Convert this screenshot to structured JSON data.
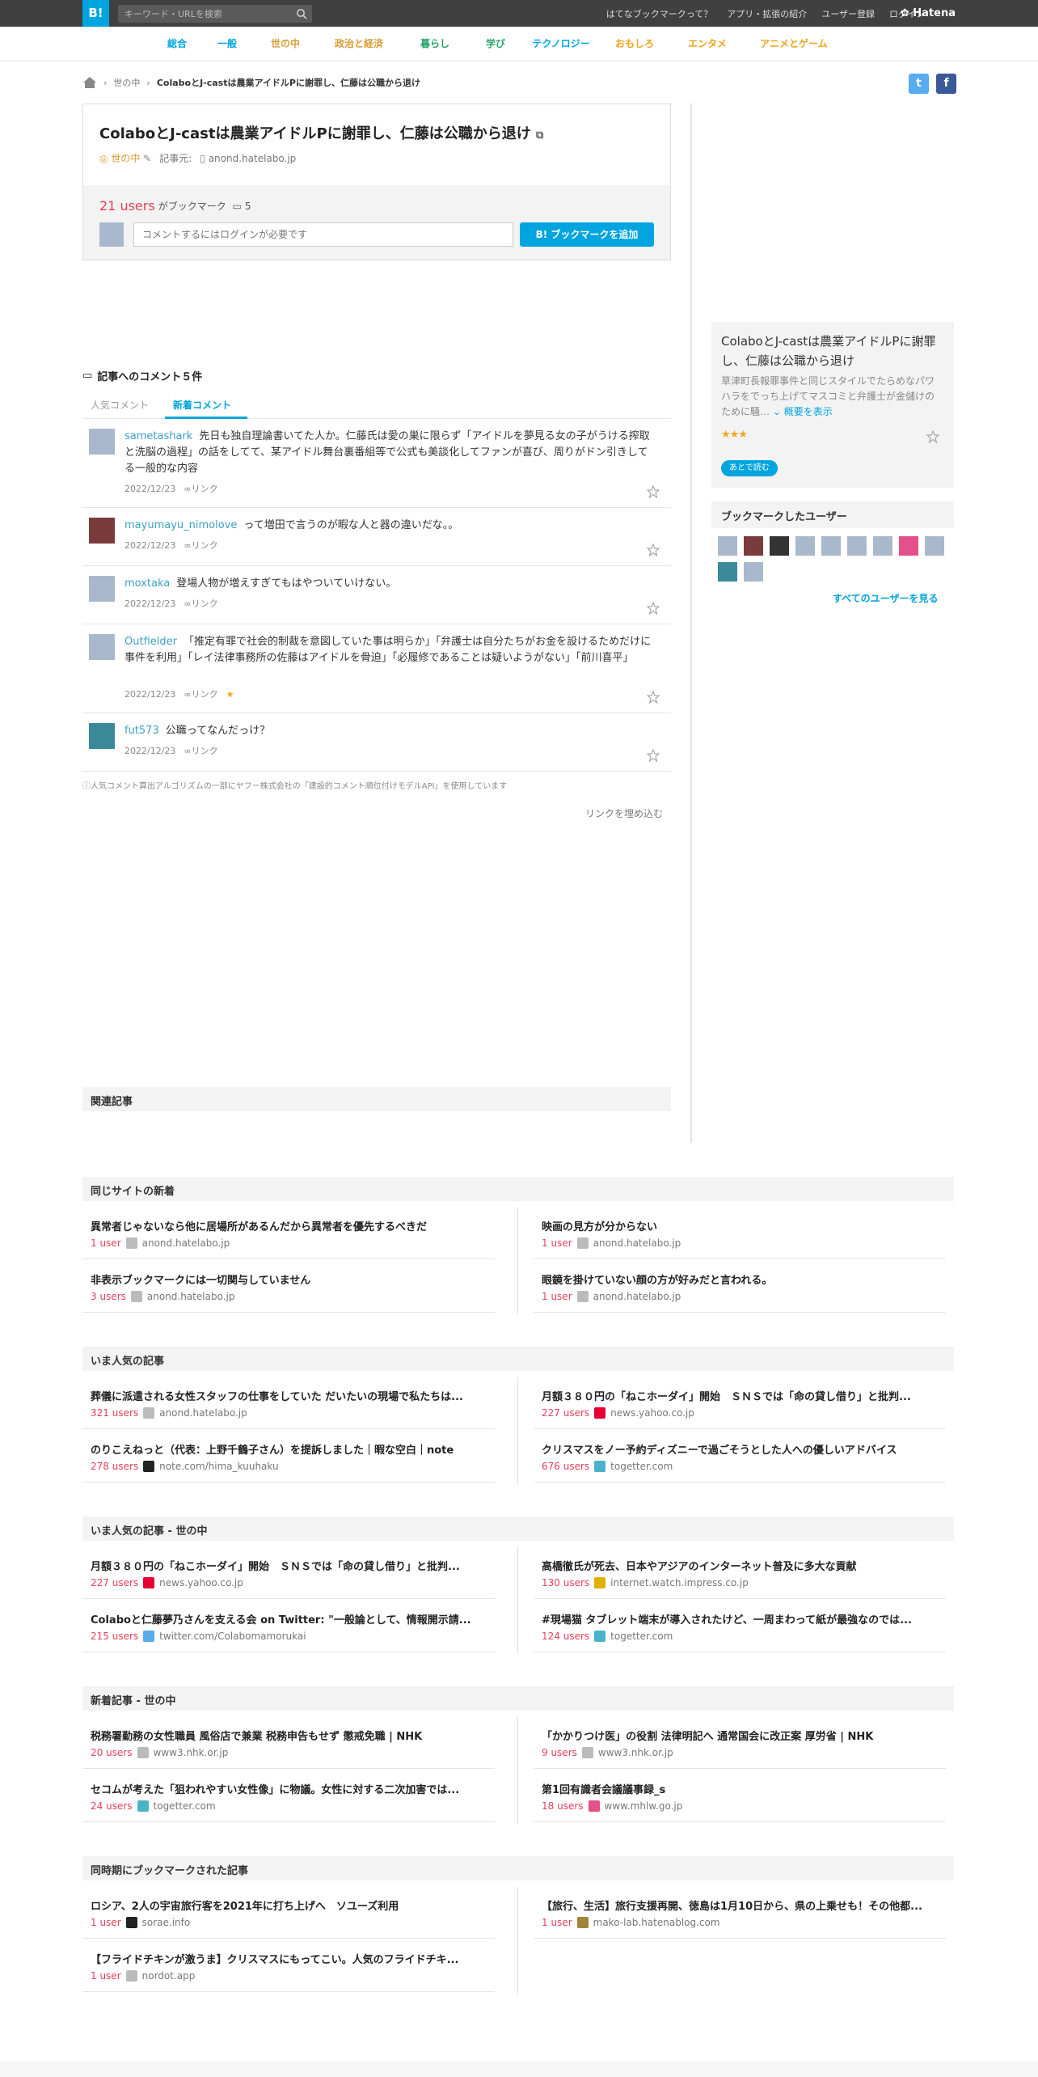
{
  "header": {
    "logo": "B!",
    "search_placeholder": "キーワード・URLを検索",
    "nav": [
      "はてなブックマークって？",
      "アプリ・拡張の紹介",
      "ユーザー登録",
      "ログイン"
    ],
    "brand": "Hatena"
  },
  "categories": [
    {
      "label": "総合",
      "color": "#00a4de"
    },
    {
      "label": "一般",
      "color": "#00a4de"
    },
    {
      "label": "世の中",
      "color": "#d79e3a"
    },
    {
      "label": "政治と経済",
      "color": "#d79e3a"
    },
    {
      "label": "暮らし",
      "color": "#2ba46e"
    },
    {
      "label": "学び",
      "color": "#2ba46e"
    },
    {
      "label": "テクノロジー",
      "color": "#00a4de"
    },
    {
      "label": "おもしろ",
      "color": "#f0a31d"
    },
    {
      "label": "エンタメ",
      "color": "#f0a31d"
    },
    {
      "label": "アニメとゲーム",
      "color": "#f0a31d"
    }
  ],
  "breadcrumb": {
    "category": "世の中",
    "current": "ColaboとJ-castは農業アイドルPに謝罪し、仁藤は公職から退け"
  },
  "entry": {
    "title": "ColaboとJ-castは農業アイドルPに謝罪し、仁藤は公職から退け",
    "category": "世の中",
    "source_label": "記事元:",
    "source": "anond.hatelabo.jp",
    "users_count": "21 users",
    "users_suffix": "がブックマーク",
    "comment_count": "5",
    "comment_placeholder": "コメントするにはログインが必要です",
    "bookmark_button": "ブックマークを追加"
  },
  "comments_section": {
    "heading": "記事へのコメント５件",
    "tab_popular": "人気コメント",
    "tab_new": "新着コメント",
    "link_label": "リンク",
    "items": [
      {
        "user": "sametashark",
        "text": "先日も独自理論書いてた人か。仁藤氏は愛の巣に限らず「アイドルを夢見る女の子がうける搾取と洗脳の過程」の話をしてて、某アイドル舞台裏番組等で公式も美談化してファンが喜び、周りがドン引きしてる一般的な内容",
        "date": "2022/12/23"
      },
      {
        "user": "mayumayu_nimolove",
        "text": "って増田で言うのが暇な人と器の違いだな。。",
        "date": "2022/12/23"
      },
      {
        "user": "moxtaka",
        "text": "登場人物が増えすぎてもはやついていけない。",
        "date": "2022/12/23"
      },
      {
        "user": "Outfielder",
        "text": "「推定有罪で社会的制裁を意図していた事は明らか」「弁護士は自分たちがお金を設けるためだけに事件を利用」「レイ法律事務所の佐藤はアイドルを骨迫」「必履修であることは疑いようがない」「前川喜平」",
        "date": "2022/12/23"
      },
      {
        "user": "fut573",
        "text": "公職ってなんだっけ？",
        "date": "2022/12/23"
      }
    ],
    "notice": "ⓘ人気コメント算出アルゴリズムの一部にヤフー株式会社の「建設的コメント順位付けモデルAPI」を使用しています",
    "embed": "リンクを埋め込む"
  },
  "related": {
    "heading": "関連記事"
  },
  "sidebar": {
    "title": "ColaboとJ-castは農業アイドルPに謝罪し、仁藤は公職から退け",
    "desc": "草津町長報罪事件と同じスタイルでたらめなパワハラをでっち上げてマスコミと弁護士が金儲けのために騒…",
    "summary_link": "概要を表示",
    "stars": "★★★",
    "later_button": "あとで読む",
    "users_heading": "ブックマークしたユーザー",
    "see_all": "すべてのユーザーを見る"
  },
  "sections": [
    {
      "heading": "同じサイトの新着",
      "items": [
        {
          "title": "異常者じゃないなら他に居場所があるんだから異常者を優先するべきだ",
          "users": "1 user",
          "site": "anond.hatelabo.jp"
        },
        {
          "title": "映画の見方が分からない",
          "users": "1 user",
          "site": "anond.hatelabo.jp"
        },
        {
          "title": "非表示ブックマークには一切関与していません",
          "users": "3 users",
          "site": "anond.hatelabo.jp"
        },
        {
          "title": "眼鏡を掛けていない顔の方が好みだと言われる。",
          "users": "1 user",
          "site": "anond.hatelabo.jp"
        }
      ]
    },
    {
      "heading": "いま人気の記事",
      "items": [
        {
          "title": "葬儀に派遣される女性スタッフの仕事をしていた だいたいの現場で私たちは...",
          "users": "321 users",
          "site": "anond.hatelabo.jp"
        },
        {
          "title": "月額３８０円の「ねこホーダイ」開始　ＳＮＳでは「命の貸し借り」と批判...",
          "users": "227 users",
          "site": "news.yahoo.co.jp"
        },
        {
          "title": "のりこえねっと（代表：上野千鶴子さん）を提訴しました｜暇な空白｜note",
          "users": "278 users",
          "site": "note.com/hima_kuuhaku"
        },
        {
          "title": "クリスマスをノー予約ディズニーで過ごそうとした人への優しいアドバイス",
          "users": "676 users",
          "site": "togetter.com"
        }
      ]
    },
    {
      "heading": "いま人気の記事 - 世の中",
      "items": [
        {
          "title": "月額３８０円の「ねこホーダイ」開始　ＳＮＳでは「命の貸し借り」と批判...",
          "users": "227 users",
          "site": "news.yahoo.co.jp"
        },
        {
          "title": "高橋徹氏が死去、日本やアジアのインターネット普及に多大な貢献",
          "users": "130 users",
          "site": "internet.watch.impress.co.jp"
        },
        {
          "title": "Colaboと仁藤夢乃さんを支える会 on Twitter: \"一般論として、情報開示請...",
          "users": "215 users",
          "site": "twitter.com/Colabomamorukai"
        },
        {
          "title": "#現場猫 タブレット端末が導入されたけど、一周まわって紙が最強なのでは...",
          "users": "124 users",
          "site": "togetter.com"
        }
      ]
    },
    {
      "heading": "新着記事 - 世の中",
      "items": [
        {
          "title": "税務署勤務の女性職員 風俗店で兼業 税務申告もせず 懲戒免職 | NHK",
          "users": "20 users",
          "site": "www3.nhk.or.jp"
        },
        {
          "title": "「かかりつけ医」の役割 法律明記へ 通常国会に改正案 厚労省 | NHK",
          "users": "9 users",
          "site": "www3.nhk.or.jp"
        },
        {
          "title": "セコムが考えた「狙われやすい女性像」に物議。女性に対する二次加害では...",
          "users": "24 users",
          "site": "togetter.com"
        },
        {
          "title": "第1回有識者会議議事録_s",
          "users": "18 users",
          "site": "www.mhlw.go.jp"
        }
      ]
    },
    {
      "heading": "同時期にブックマークされた記事",
      "items": [
        {
          "title": "ロシア、2人の宇宙旅行客を2021年に打ち上げへ　ソユーズ利用",
          "users": "1 user",
          "site": "sorae.info"
        },
        {
          "title": "【旅行、生活】旅行支援再開、徳島は1月10日から、県の上乗せも！その他都...",
          "users": "1 user",
          "site": "mako-lab.hatenablog.com"
        },
        {
          "title": "【フライドチキンが激うま】クリスマスにもってこい。人気のフライドチキ...",
          "users": "1 user",
          "site": "nordot.app"
        }
      ]
    }
  ]
}
